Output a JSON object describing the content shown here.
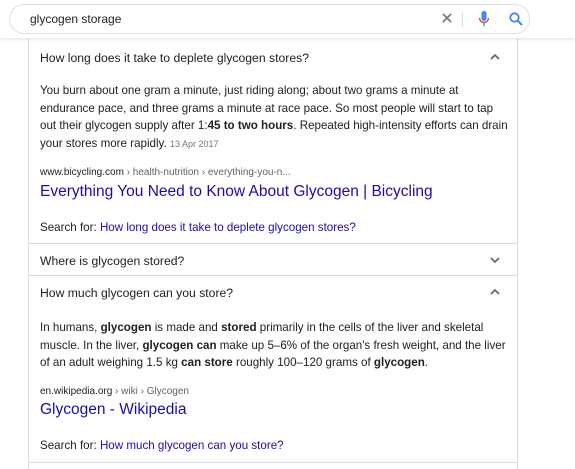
{
  "search": {
    "query": "glycogen storage"
  },
  "questions": [
    {
      "question": "How long does it take to deplete glycogen stores?",
      "expanded": true,
      "answer": {
        "t1": "You burn about one gram a minute, just riding along; about two grams a minute at endurance pace, and three grams a minute at race pace. So most people will start to tap out their glycogen supply after 1:",
        "b1": "45 to two hours",
        "t2": ". Repeated high-intensity efforts can drain your stores more rapidly.",
        "date": "13 Apr 2017"
      },
      "cite_domain": "www.bicycling.com",
      "cite_path": " › health-nutrition › everything-you-n...",
      "result_title": "Everything You Need to Know About Glycogen | Bicycling",
      "search_for_label": "Search for: ",
      "search_for_link": "How long does it take to deplete glycogen stores?"
    },
    {
      "question": "Where is glycogen stored?",
      "expanded": false
    },
    {
      "question": "How much glycogen can you store?",
      "expanded": true,
      "answer": {
        "t1": "In humans, ",
        "b1": "glycogen",
        "t2": " is made and ",
        "b2": "stored",
        "t3": " primarily in the cells of the liver and skeletal muscle. In the liver, ",
        "b3": "glycogen can",
        "t4": " make up 5–6% of the organ's fresh weight, and the liver of an adult weighing 1.5 kg ",
        "b4": "can store",
        "t5": " roughly 100–120 grams of ",
        "b5": "glycogen",
        "t6": "."
      },
      "cite_domain": "en.wikipedia.org",
      "cite_path": " › wiki › Glycogen",
      "result_title": "Glycogen - Wikipedia",
      "search_for_label": "Search for: ",
      "search_for_link": "How much glycogen can you store?"
    }
  ],
  "colors": {
    "link": "#1a0dab",
    "text": "#202124",
    "muted": "#70757a",
    "border": "#dadce0",
    "mic_blue": "#4285f4",
    "mic_red": "#ea4335"
  },
  "icons": {
    "clear": "close-icon",
    "mic": "microphone-icon",
    "search": "search-icon",
    "expanded": "chevron-up-icon",
    "collapsed": "chevron-down-icon"
  }
}
